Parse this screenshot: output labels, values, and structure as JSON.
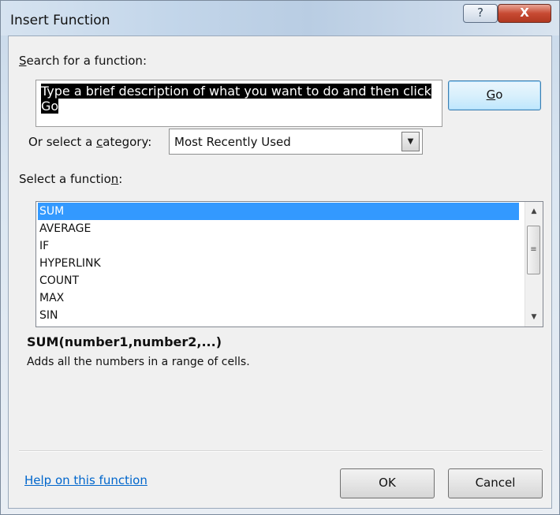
{
  "window": {
    "title": "Insert Function",
    "help_glyph": "?",
    "close_glyph": "X"
  },
  "search": {
    "label_pre": "",
    "label_key": "S",
    "label_post": "earch for a function:",
    "value": "Type a brief description of what you want to do and then click Go",
    "go_key": "G",
    "go_rest": "o"
  },
  "category": {
    "label_pre": "Or select a ",
    "label_key": "c",
    "label_post": "ategory:",
    "selected": "Most Recently Used"
  },
  "functions": {
    "label_pre": "Select a functio",
    "label_key": "n",
    "label_post": ":",
    "items": [
      "SUM",
      "AVERAGE",
      "IF",
      "HYPERLINK",
      "COUNT",
      "MAX",
      "SIN"
    ],
    "selected_index": 0
  },
  "details": {
    "signature": "SUM(number1,number2,...)",
    "description": "Adds all the numbers in a range of cells."
  },
  "footer": {
    "help_link": "Help on this function",
    "ok_label": "OK",
    "cancel_label": "Cancel"
  }
}
